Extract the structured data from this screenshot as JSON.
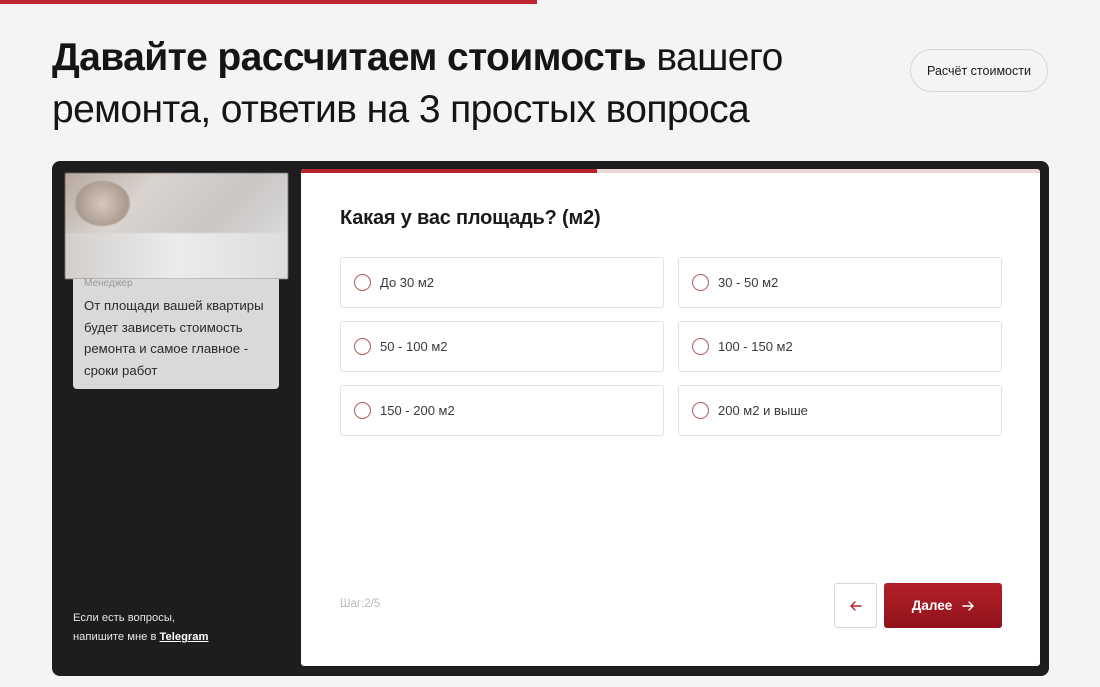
{
  "header": {
    "title_bold": "Давайте рассчитаем стоимость",
    "title_light_1": "вашего",
    "title_light_2": "ремонта, ответив на 3 простых вопроса",
    "calc_button": "Расчёт стоимости"
  },
  "sidebar": {
    "role": "Менеджер",
    "message": "От площади вашей квартиры будет зависеть стоимость ремонта и самое главное - сроки работ",
    "contact_line1": "Если есть вопросы,",
    "contact_line2": "напишите мне в ",
    "contact_link": "Telegram"
  },
  "quiz": {
    "progress": 0.4,
    "question": "Какая у вас площадь? (м2)",
    "options": [
      {
        "label": "До 30 м2"
      },
      {
        "label": "30 - 50 м2"
      },
      {
        "label": "50 - 100 м2"
      },
      {
        "label": "100 - 150 м2"
      },
      {
        "label": "150 - 200 м2"
      },
      {
        "label": "200 м2 и выше"
      }
    ],
    "step": "Шаг:2/5",
    "back_icon": "arrow-left-icon",
    "next_label": "Далее",
    "next_icon": "arrow-right-icon"
  },
  "colors": {
    "accent": "#b8242b",
    "dark_panel": "#1d1d1d",
    "page_bg": "#f4f4f4"
  }
}
